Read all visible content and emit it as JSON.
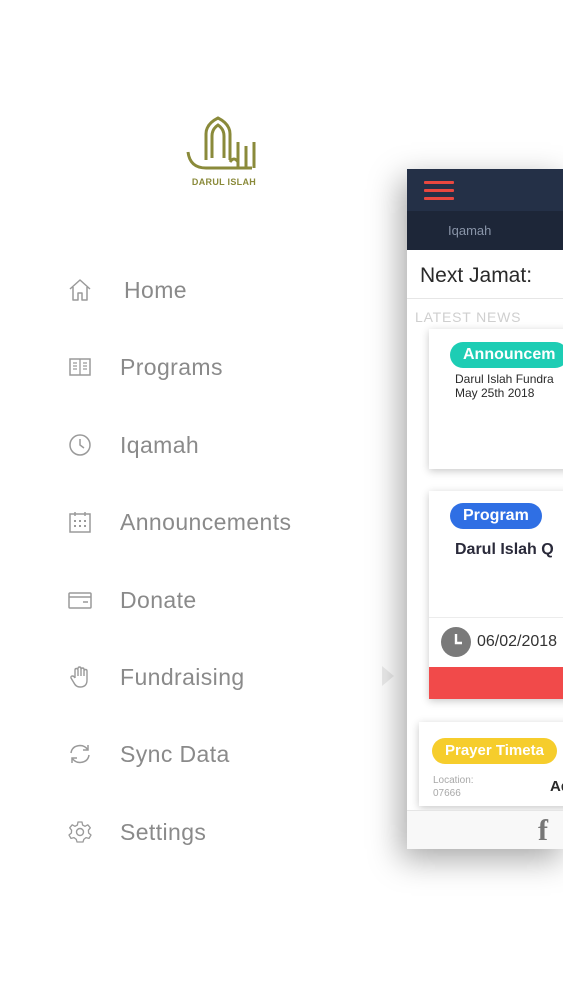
{
  "logo": {
    "name": "darul-islah-logo",
    "caption": "DARUL ISLAH"
  },
  "menu": {
    "items": [
      {
        "label": "Home",
        "icon": "home-icon"
      },
      {
        "label": "Programs",
        "icon": "book-icon"
      },
      {
        "label": "Iqamah",
        "icon": "clock-icon"
      },
      {
        "label": "Announcements",
        "icon": "calendar-icon"
      },
      {
        "label": "Donate",
        "icon": "wallet-icon"
      },
      {
        "label": "Fundraising",
        "icon": "hand-icon"
      },
      {
        "label": "Sync Data",
        "icon": "sync-icon"
      },
      {
        "label": "Settings",
        "icon": "gear-icon"
      }
    ]
  },
  "preview": {
    "tab": "Iqamah",
    "next_jamat": "Next Jamat:",
    "latest_news": "LATEST NEWS",
    "card1": {
      "badge": "Announcem",
      "title_line1": "Darul Islah Fundra",
      "title_line2": "May 25th 2018"
    },
    "card2": {
      "badge": "Program",
      "title": "Darul Islah Q",
      "date": "06/02/2018"
    },
    "card3": {
      "badge": "Prayer Timeta",
      "location_label": "Location:",
      "location_value": "07666",
      "value": "Ad"
    },
    "facebook_glyph": "f"
  },
  "colors": {
    "appbar": "#243047",
    "accent_red": "#e9473f",
    "announcement": "#1dcdb4",
    "program": "#2f6fe4",
    "prayer": "#f6cd2c"
  }
}
